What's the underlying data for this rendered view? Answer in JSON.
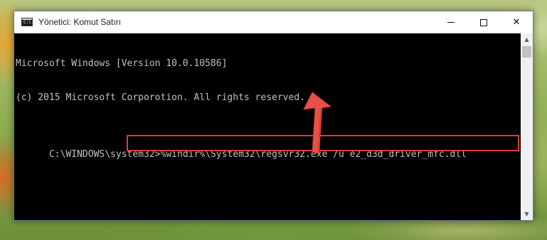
{
  "window": {
    "title": "Yönetici: Komut Satırı",
    "icon": "console-icon",
    "icon_text": "C:\\",
    "controls": {
      "minimize": "minimize-icon",
      "maximize": "maximize-icon",
      "close": "✕"
    }
  },
  "console": {
    "lines": [
      "Microsoft Windows [Version 10.0.10586]",
      "(c) 2015 Microsoft Corporotion. All rights reserved."
    ],
    "prompt": "C:\\WINDOWS\\system32>",
    "command": "%windir%\\System32\\regsvr32.exe /u e2_d3d_driver_mfc.dll"
  },
  "scrollbar": {
    "up": "▲",
    "down": "▼"
  },
  "colors": {
    "highlight": "#e03a3a",
    "arrow": "#e5473f",
    "console_text": "#c0c0c0"
  }
}
